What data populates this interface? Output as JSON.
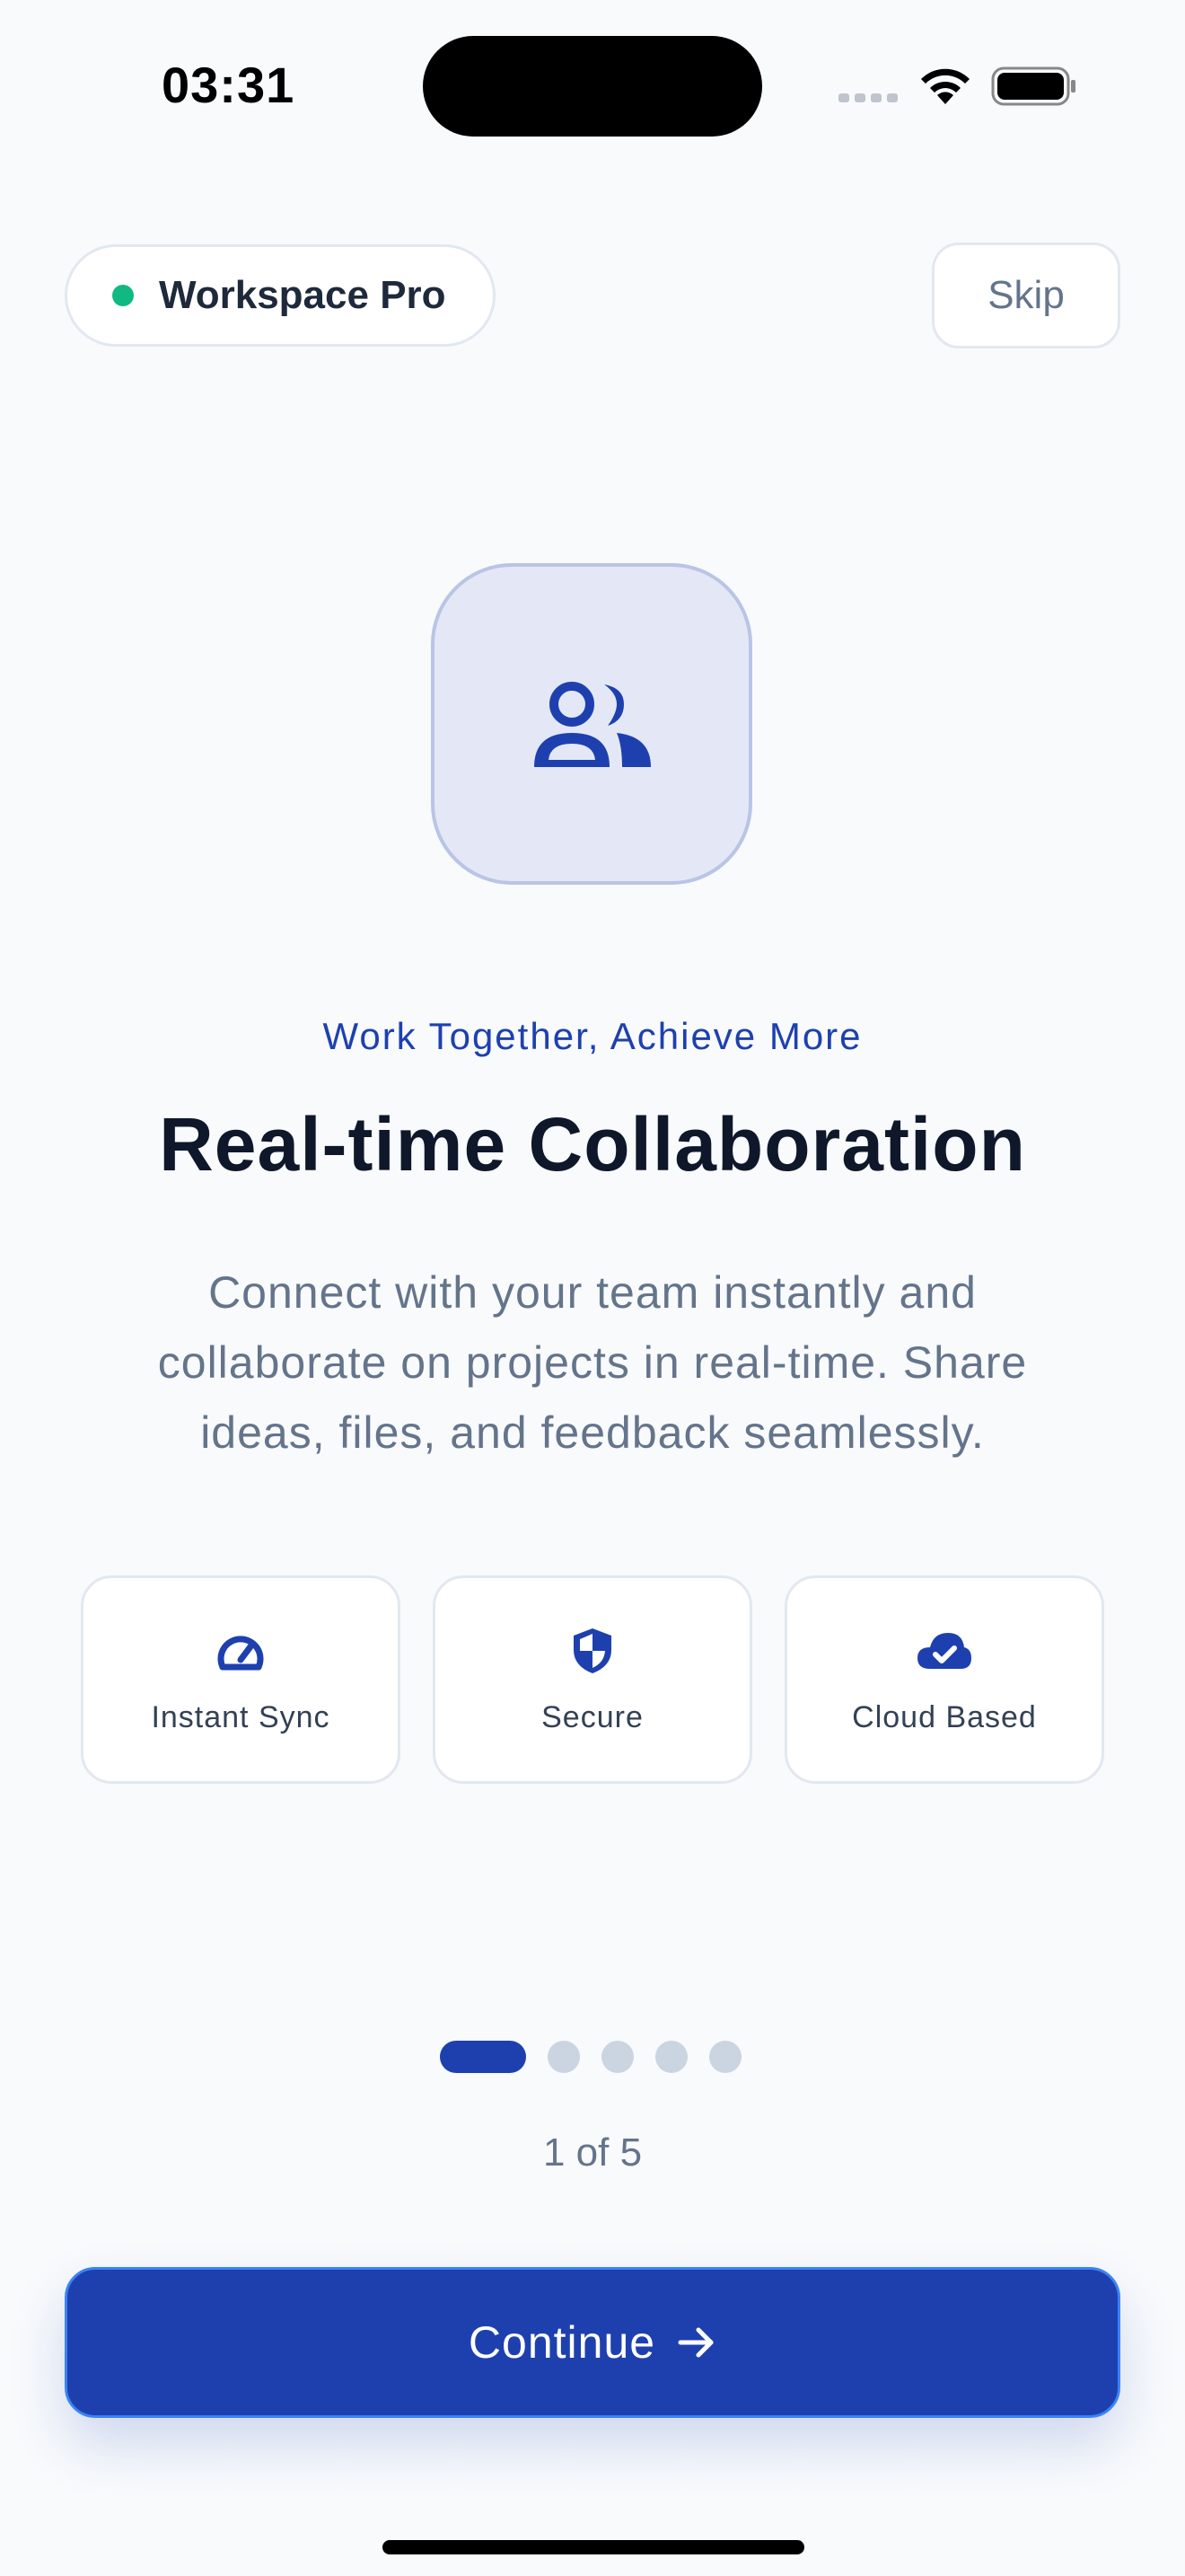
{
  "status_bar": {
    "time": "03:31"
  },
  "header": {
    "brand_name": "Workspace Pro",
    "brand_status_color": "#10b981",
    "skip_label": "Skip"
  },
  "hero": {
    "icon": "users-icon",
    "subtitle": "Work Together, Achieve More",
    "title": "Real-time Collaboration",
    "description": "Connect with your team instantly and collaborate on projects in real-time. Share ideas, files, and feedback seamlessly."
  },
  "features": [
    {
      "icon": "speedometer-icon",
      "label": "Instant Sync"
    },
    {
      "icon": "shield-icon",
      "label": "Secure"
    },
    {
      "icon": "cloud-check-icon",
      "label": "Cloud Based"
    }
  ],
  "pager": {
    "current": 1,
    "total": 5,
    "label": "1 of 5"
  },
  "cta": {
    "label": "Continue",
    "icon": "arrow-right-icon"
  },
  "colors": {
    "accent": "#1e40af",
    "background": "#f8fafc",
    "title": "#0f172a",
    "muted": "#64748b"
  }
}
